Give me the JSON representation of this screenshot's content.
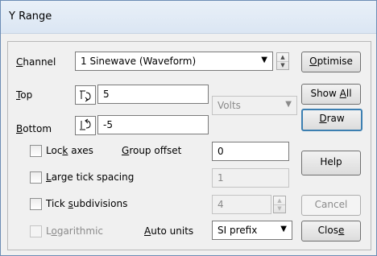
{
  "window": {
    "title": "Y Range"
  },
  "channel": {
    "label_u": "C",
    "label_rest": "hannel",
    "value": "1 Sinewave (Waveform)"
  },
  "top": {
    "label_u": "T",
    "label_rest": "op",
    "value": "5"
  },
  "bottom": {
    "label_u": "B",
    "label_rest": "ottom",
    "value": "-5"
  },
  "units": {
    "value": "Volts"
  },
  "lock_axes": {
    "label_pre": "Loc",
    "label_u": "k",
    "label_post": " axes",
    "checked": false
  },
  "group_offset": {
    "label_u": "G",
    "label_rest": "roup offset",
    "value": "0"
  },
  "large_tick": {
    "label_u": "L",
    "label_rest": "arge tick spacing",
    "value": "1",
    "checked": false
  },
  "tick_subdiv": {
    "label_pre": "Tick ",
    "label_u": "s",
    "label_post": "ubdivisions",
    "value": "4",
    "checked": false
  },
  "logarithmic": {
    "label_pre": "L",
    "label_u": "o",
    "label_post": "garithmic",
    "checked": false
  },
  "auto_units": {
    "label_u": "A",
    "label_rest": "uto units",
    "value": "SI prefix"
  },
  "buttons": {
    "optimise": {
      "u": "O",
      "rest": "ptimise"
    },
    "show_all": {
      "pre": "Show ",
      "u": "A",
      "post": "ll"
    },
    "draw": {
      "u": "D",
      "rest": "raw"
    },
    "help": {
      "label": "Help"
    },
    "cancel": {
      "label": "Cancel"
    },
    "close": {
      "pre": "Clos",
      "u": "e"
    }
  },
  "icons": {
    "top_lock": "lock-top-icon",
    "bottom_lock": "lock-bottom-icon"
  }
}
